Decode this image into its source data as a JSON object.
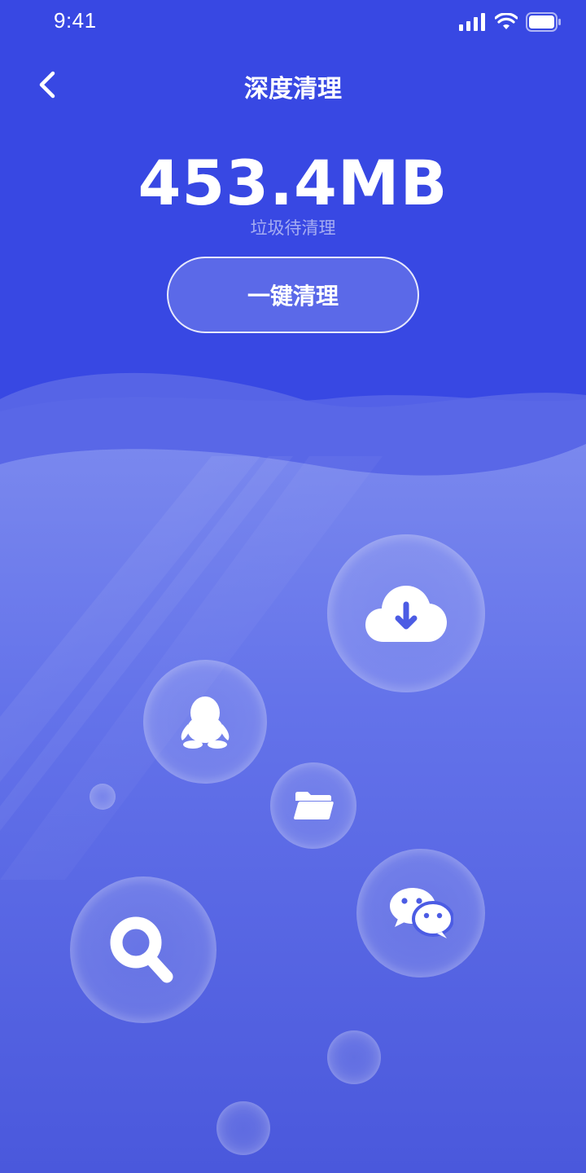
{
  "status_bar": {
    "time": "9:41"
  },
  "header": {
    "title": "深度清理"
  },
  "junk": {
    "size": "453.4MB",
    "caption": "垃圾待清理"
  },
  "action": {
    "label": "一键清理"
  },
  "bubbles": [
    {
      "name": "download-bubble",
      "icon": "cloud-download-icon"
    },
    {
      "name": "qq-bubble",
      "icon": "qq-penguin-icon"
    },
    {
      "name": "folder-bubble",
      "icon": "folder-icon"
    },
    {
      "name": "wechat-bubble",
      "icon": "wechat-icon"
    },
    {
      "name": "search-bubble",
      "icon": "search-icon"
    }
  ],
  "colors": {
    "background": "#3848e3",
    "text": "#ffffff"
  }
}
